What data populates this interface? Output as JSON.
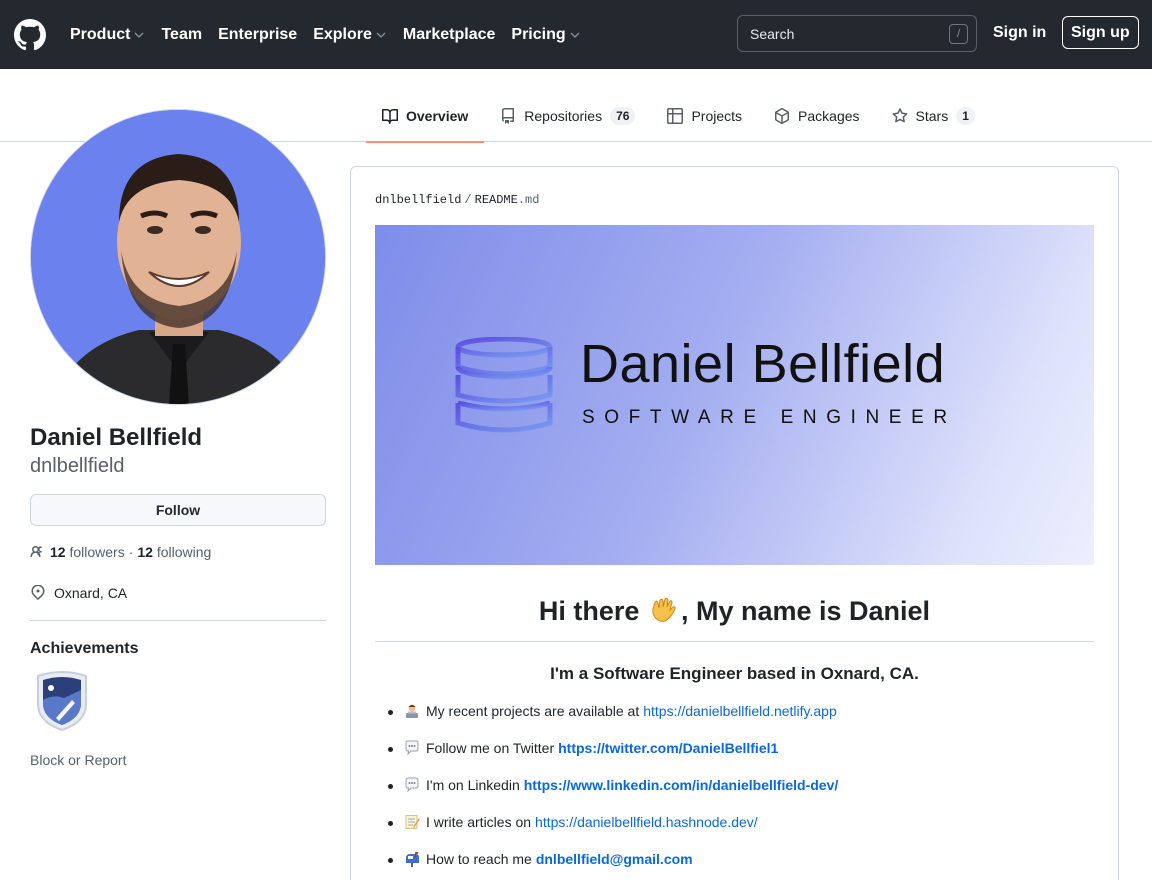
{
  "header": {
    "nav": [
      {
        "label": "Product",
        "dropdown": true
      },
      {
        "label": "Team",
        "dropdown": false
      },
      {
        "label": "Enterprise",
        "dropdown": false
      },
      {
        "label": "Explore",
        "dropdown": true
      },
      {
        "label": "Marketplace",
        "dropdown": false
      },
      {
        "label": "Pricing",
        "dropdown": true
      }
    ],
    "search_placeholder": "Search",
    "search_key": "/",
    "sign_in": "Sign in",
    "sign_up": "Sign up"
  },
  "tabs": [
    {
      "label": "Overview",
      "icon": "book-icon",
      "active": true
    },
    {
      "label": "Repositories",
      "icon": "repo-icon",
      "count": "76"
    },
    {
      "label": "Projects",
      "icon": "table-icon"
    },
    {
      "label": "Packages",
      "icon": "package-icon"
    },
    {
      "label": "Stars",
      "icon": "star-icon",
      "count": "1"
    }
  ],
  "profile": {
    "full_name": "Daniel Bellfield",
    "username": "dnlbellfield",
    "follow_label": "Follow",
    "followers_count": "12",
    "followers_label": "followers",
    "separator": "·",
    "following_count": "12",
    "following_label": "following",
    "location": "Oxnard, CA",
    "achievements_title": "Achievements",
    "block_report": "Block or Report"
  },
  "readme": {
    "crumb_user": "dnlbellfield",
    "crumb_sep": "/",
    "crumb_file": "README",
    "crumb_ext": ".md",
    "banner_name": "Daniel Bellfield",
    "banner_role": "SOFTWARE ENGINEER",
    "heading_pre": "Hi there",
    "heading_post": ", My name is Daniel",
    "subheading": "I'm a Software Engineer based in Oxnard, CA.",
    "items": [
      {
        "emoji": "👩‍💻",
        "text": "My recent projects are available at",
        "link": "https://danielbellfield.netlify.app"
      },
      {
        "emoji": "💬",
        "text": "Follow me on Twitter",
        "link": "https://twitter.com/DanielBellfiel1"
      },
      {
        "emoji": "💬",
        "text": "I'm on Linkedin",
        "link": "https://www.linkedin.com/in/danielbellfield-dev/"
      },
      {
        "emoji": "📝",
        "text": "I write articles on",
        "link": "https://danielbellfield.hashnode.dev/"
      },
      {
        "emoji": "📫",
        "text": "How to reach me",
        "link": "dnlbellfield@gmail.com"
      }
    ]
  },
  "colors": {
    "header_bg": "#24292f",
    "link": "#0969da",
    "tab_underline": "#fd8c73",
    "avatar_bg": "#6b82ee"
  }
}
